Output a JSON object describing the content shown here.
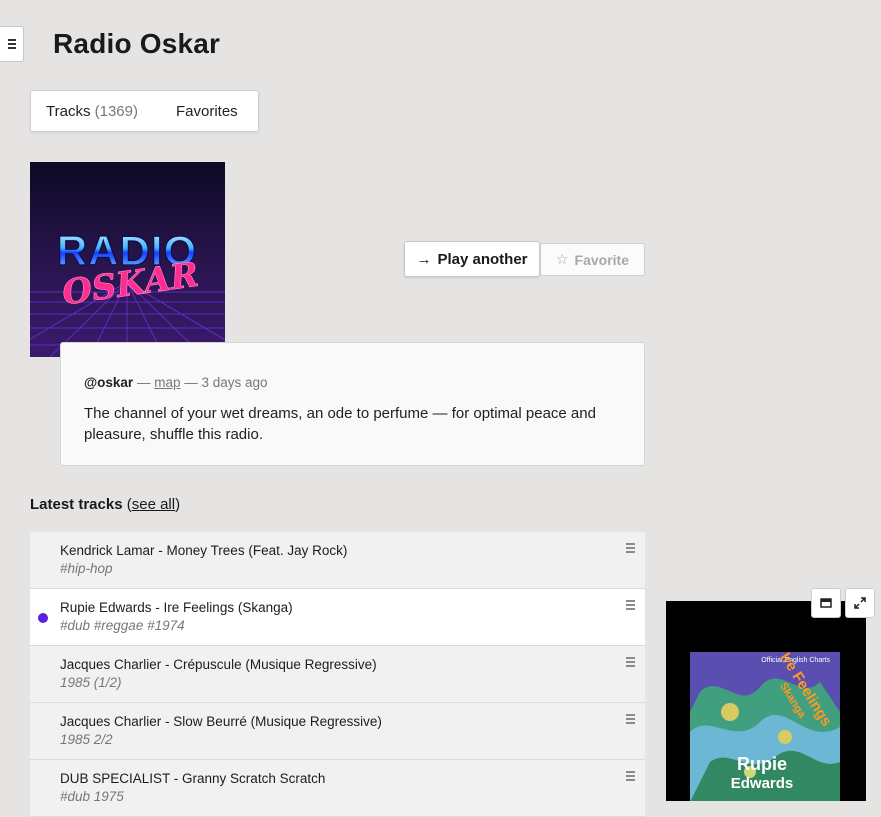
{
  "page": {
    "title": "Radio Oskar"
  },
  "tabs": [
    {
      "label": "Tracks",
      "count": "(1369)"
    },
    {
      "label": "Favorites"
    }
  ],
  "cover": {
    "line1": "RADIO",
    "line2": "OSKAR"
  },
  "actions": {
    "play_arrow": "→",
    "play_label": "Play another",
    "favorite_star": "☆",
    "favorite_label": "Favorite"
  },
  "channel": {
    "author": "@oskar",
    "separator": "—",
    "map_link": "map",
    "time": "— 3 days ago",
    "description": "The channel of your wet dreams, an ode to perfume — for optimal peace and pleasure, shuffle this radio."
  },
  "latest": {
    "label": "Latest tracks",
    "open_paren": " (",
    "see_all": "see all",
    "close_paren": ")"
  },
  "tracks": [
    {
      "title": "Kendrick Lamar - Money Trees (Feat. Jay Rock)",
      "tags": "#hip-hop"
    },
    {
      "title": "Rupie Edwards - Ire Feelings (Skanga)",
      "tags": "#dub #reggae #1974"
    },
    {
      "title": "Jacques Charlier - Crépuscule (Musique Regressive)",
      "tags": "1985 (1/2)"
    },
    {
      "title": "Jacques Charlier - Slow Beurré (Musique Regressive)",
      "tags": "1985 2/2"
    },
    {
      "title": "DUB SPECIALIST - Granny Scratch Scratch",
      "tags": "#dub 1975"
    }
  ],
  "player": {
    "art_top_text": "Official English Charts",
    "art_song": "Ire Feelings",
    "art_sub": "Skanga",
    "art_artist_first": "Rupie",
    "art_artist_last": "Edwards"
  },
  "colors": {
    "background": "#e6e4e2",
    "accent_dot": "#5b1fe0",
    "active_row": "#ffffff",
    "row": "#f1f1f1"
  }
}
